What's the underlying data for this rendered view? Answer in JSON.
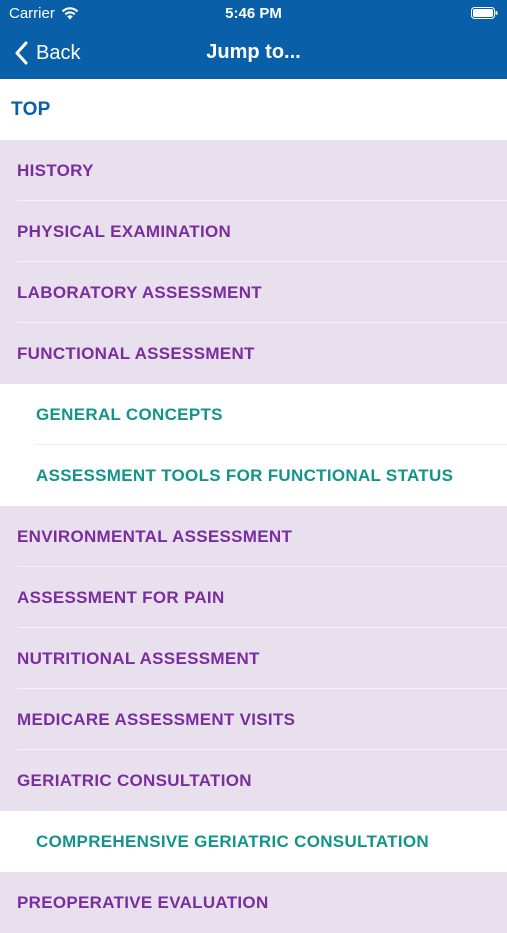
{
  "status_bar": {
    "carrier": "Carrier",
    "time": "5:46 PM"
  },
  "nav": {
    "back_label": "Back",
    "title": "Jump to..."
  },
  "list": {
    "top": "TOP",
    "items": [
      {
        "label": "HISTORY",
        "level": "section"
      },
      {
        "label": "PHYSICAL EXAMINATION",
        "level": "section"
      },
      {
        "label": "LABORATORY ASSESSMENT",
        "level": "section"
      },
      {
        "label": "FUNCTIONAL ASSESSMENT",
        "level": "section"
      },
      {
        "label": "GENERAL CONCEPTS",
        "level": "sub"
      },
      {
        "label": "ASSESSMENT TOOLS FOR FUNCTIONAL STATUS",
        "level": "sub"
      },
      {
        "label": "ENVIRONMENTAL ASSESSMENT",
        "level": "section"
      },
      {
        "label": "ASSESSMENT FOR PAIN",
        "level": "section"
      },
      {
        "label": "NUTRITIONAL ASSESSMENT",
        "level": "section"
      },
      {
        "label": "MEDICARE ASSESSMENT VISITS",
        "level": "section"
      },
      {
        "label": "GERIATRIC CONSULTATION",
        "level": "section"
      },
      {
        "label": "COMPREHENSIVE GERIATRIC CONSULTATION",
        "level": "sub"
      },
      {
        "label": "PREOPERATIVE EVALUATION",
        "level": "section"
      }
    ]
  },
  "colors": {
    "header": "#0a60a8",
    "section_bg": "#e9e0ee",
    "section_text": "#7a2d9e",
    "sub_text": "#13948a",
    "top_text": "#0a60a8"
  }
}
